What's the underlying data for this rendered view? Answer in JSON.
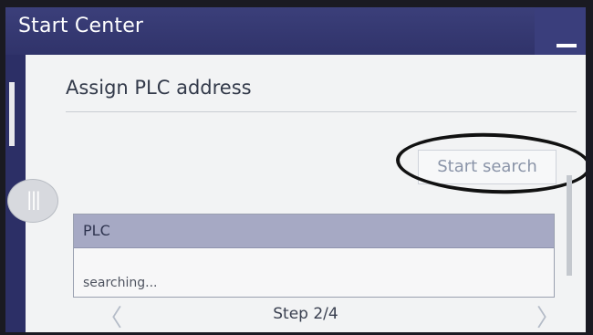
{
  "window": {
    "title": "Start Center",
    "minimize_icon": "minimize-icon"
  },
  "page": {
    "heading": "Assign PLC address"
  },
  "search": {
    "button_label": "Start search"
  },
  "menu": {
    "icon": "three-bars-icon",
    "glyph": "|||"
  },
  "table": {
    "header": "PLC",
    "rows": [
      "searching..."
    ]
  },
  "navigation": {
    "prev_icon": "chevron-left-icon",
    "prev_glyph": "〈",
    "step_label": "Step 2/4",
    "next_icon": "chevron-right-icon",
    "next_glyph": "〉"
  },
  "colors": {
    "titlebar": "#30336a",
    "table_header": "#a6a9c4",
    "panel": "#f2f3f4"
  }
}
